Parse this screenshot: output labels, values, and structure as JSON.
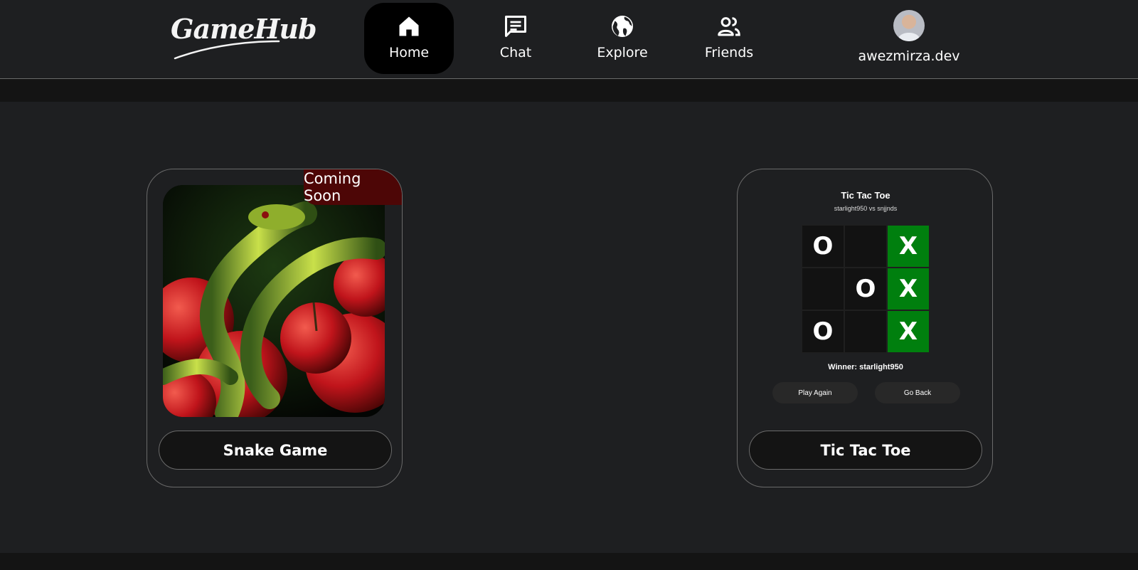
{
  "brand": {
    "logo_text": "GameHub"
  },
  "nav": {
    "items": [
      {
        "label": "Home",
        "icon": "home-icon",
        "active": true
      },
      {
        "label": "Chat",
        "icon": "chat-icon",
        "active": false
      },
      {
        "label": "Explore",
        "icon": "globe-icon",
        "active": false
      },
      {
        "label": "Friends",
        "icon": "friends-icon",
        "active": false
      }
    ],
    "profile": {
      "username": "awezmirza.dev",
      "icon": "avatar"
    }
  },
  "games": [
    {
      "name": "Snake Game",
      "badge": "Coming Soon",
      "image": "snake-with-apples-illustration"
    },
    {
      "name": "Tic Tac Toe",
      "preview": {
        "title": "Tic Tac Toe",
        "players": "starlight950 vs snjjnds",
        "board": [
          "O",
          "",
          "X",
          "",
          "O",
          "X",
          "O",
          "",
          "X"
        ],
        "winning_cells": [
          2,
          5,
          8
        ],
        "winner_text": "Winner: starlight950",
        "play_again_label": "Play Again",
        "go_back_label": "Go Back"
      }
    }
  ],
  "colors": {
    "background": "#1e1f21",
    "active_nav": "#000000",
    "badge": "#4d0606",
    "win_cell": "#007f0e"
  }
}
